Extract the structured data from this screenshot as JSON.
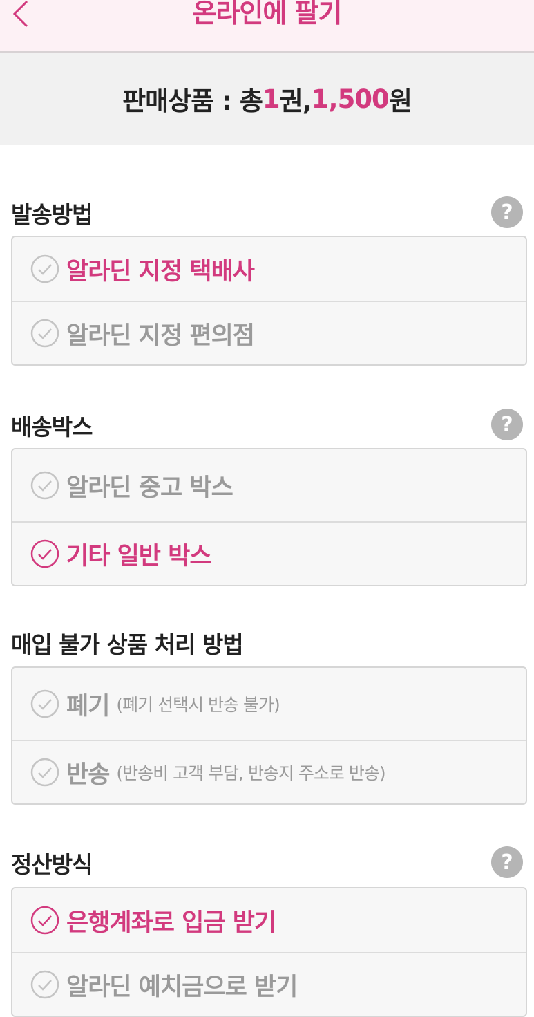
{
  "header": {
    "title": "온라인에 팔기",
    "back_icon": "chevron-left-icon"
  },
  "summary": {
    "prefix": "판매상품 : 총 ",
    "count": "1",
    "count_unit": "권, ",
    "amount": "1,500",
    "amount_unit": "원"
  },
  "colors": {
    "accent": "#d23a7e",
    "inactive": "#9a9a9a",
    "header_bg": "#fdf1f5"
  },
  "sections": {
    "shipping": {
      "label": "발송방법",
      "help": "?",
      "options": [
        {
          "label": "알라딘 지정 택배사",
          "selected": true
        },
        {
          "label": "알라딘 지정 편의점",
          "selected": false
        }
      ]
    },
    "box": {
      "label": "배송박스",
      "help": "?",
      "options": [
        {
          "label": "알라딘 중고 박스",
          "selected": false
        },
        {
          "label": "기타 일반 박스",
          "selected": true
        }
      ]
    },
    "rejected": {
      "label": "매입 불가 상품 처리 방법",
      "options": [
        {
          "label": "폐기",
          "note": "(폐기 선택시 반송 불가)",
          "selected": false
        },
        {
          "label": "반송",
          "note": "(반송비 고객 부담, 반송지 주소로 반송)",
          "selected": false
        }
      ]
    },
    "settlement": {
      "label": "정산방식",
      "help": "?",
      "options": [
        {
          "label": "은행계좌로 입금 받기",
          "selected": true
        },
        {
          "label": "알라딘 예치금으로 받기",
          "selected": false
        }
      ]
    }
  }
}
